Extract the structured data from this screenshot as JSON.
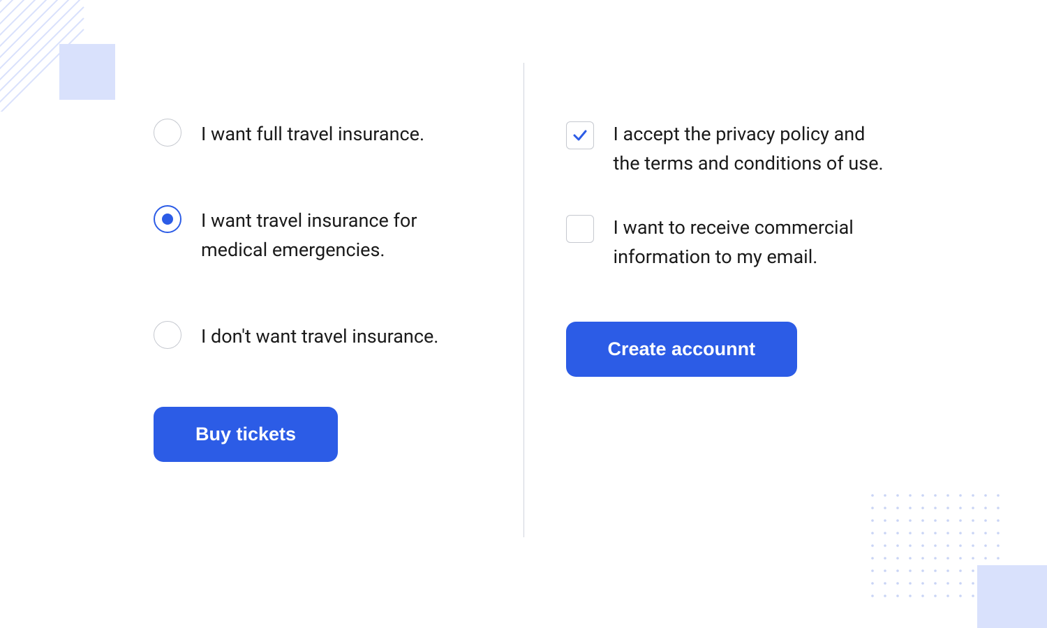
{
  "insurance": {
    "options": [
      {
        "label": "I want full travel insurance.",
        "selected": false
      },
      {
        "label": "I want travel insurance for medical emergencies.",
        "selected": true
      },
      {
        "label": "I don't want travel insurance.",
        "selected": false
      }
    ],
    "button": "Buy tickets"
  },
  "account": {
    "checkboxes": [
      {
        "label": "I accept the privacy policy and the terms and conditions of use.",
        "checked": true
      },
      {
        "label": "I want to receive commercial information to my email.",
        "checked": false
      }
    ],
    "button": "Create accounnt"
  },
  "colors": {
    "primary": "#2C5CE6",
    "decor": "#D9E1FC",
    "border": "#C5C8CF"
  }
}
